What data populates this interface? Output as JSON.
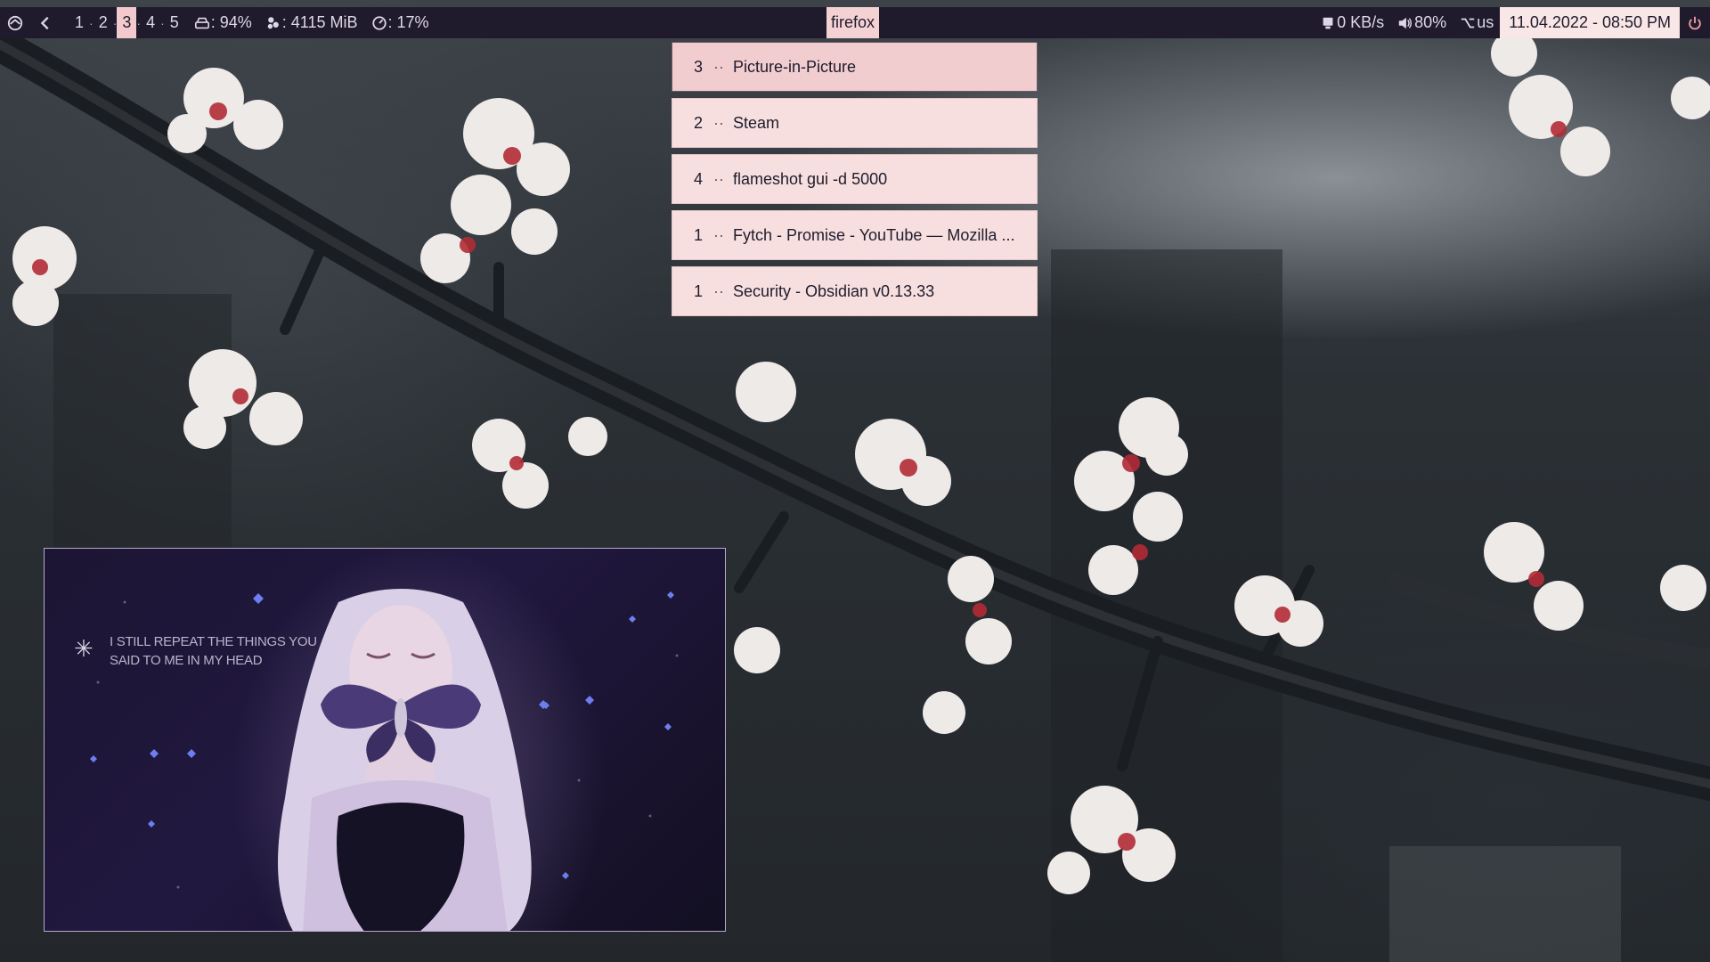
{
  "topbar": {
    "workspaces": [
      "1",
      "2",
      "3",
      "4",
      "5"
    ],
    "active_workspace": "3",
    "disk": ": 94%",
    "memory": ": 4115 MiB",
    "cpu": ": 17%",
    "window_title": "firefox",
    "network": "0 KB/s",
    "volume": "80%",
    "keyboard_layout": "us",
    "clock": "11.04.2022 - 08:50 PM",
    "icons": {
      "launcher": "arch-icon",
      "back": "chevron-left-icon",
      "disk": "hard-drive-icon",
      "memory": "memory-icon",
      "cpu": "gauge-icon",
      "network": "computer-icon",
      "volume": "speaker-icon",
      "keyboard": "option-key-icon",
      "power": "power-icon"
    },
    "colors": {
      "bar_bg": "#1f1b2c",
      "accent": "#f2c9cc",
      "clock_bg": "#f9e6e6",
      "power": "#f1a0a6"
    }
  },
  "window_switcher": {
    "sep": "··",
    "items": [
      {
        "workspace": "3",
        "title": "Picture-in-Picture",
        "selected": true
      },
      {
        "workspace": "2",
        "title": "Steam",
        "selected": false
      },
      {
        "workspace": "4",
        "title": "flameshot gui -d 5000",
        "selected": false
      },
      {
        "workspace": "1",
        "title": "Fytch - Promise - YouTube — Mozilla ...",
        "selected": false
      },
      {
        "workspace": "1",
        "title": "Security - Obsidian v0.13.33",
        "selected": false
      }
    ]
  },
  "pip": {
    "quote_line1": "I still repeat the things you",
    "quote_line2": "said to me in my head"
  }
}
